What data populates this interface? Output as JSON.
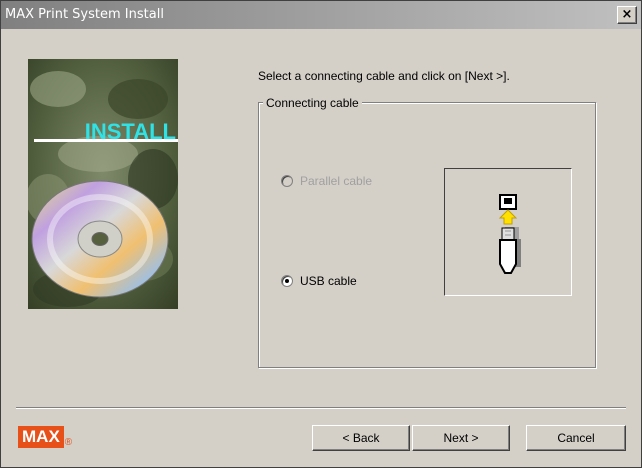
{
  "window": {
    "title": "MAX Print System Install",
    "close_glyph": "×"
  },
  "side_image": {
    "text": "INSTALL",
    "text_color": "#2fe2e6"
  },
  "instruction": "Select a connecting cable and click on [Next >].",
  "group": {
    "legend": "Connecting cable",
    "options": [
      {
        "label": "Parallel cable",
        "checked": false,
        "enabled": false
      },
      {
        "label": "USB cable",
        "checked": true,
        "enabled": true
      }
    ],
    "panel_icon": "usb-plug-icon"
  },
  "footer": {
    "logo_text": "MAX",
    "logo_reg": "®",
    "logo_color": "#e8501a",
    "buttons": {
      "back": "< Back",
      "next": "Next >",
      "cancel": "Cancel"
    }
  }
}
